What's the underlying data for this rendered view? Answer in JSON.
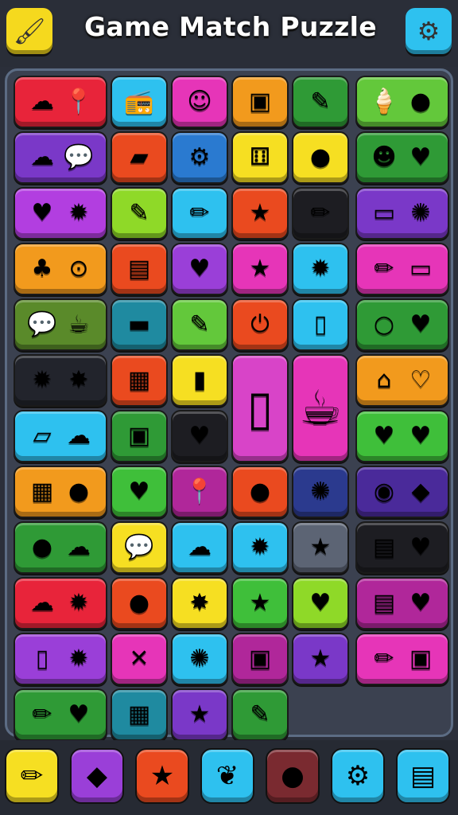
{
  "title": "Game Match Puzzle",
  "header": {
    "left_button": {
      "icon": "brush-icon",
      "glyph": "🖌",
      "color": "#f5d91e"
    },
    "right_button": {
      "icon": "gear-icon",
      "glyph": "⚙",
      "color": "#2ec1ef"
    }
  },
  "tiles": [
    {
      "row": 0,
      "col": 0,
      "span": 2,
      "color": "#e8243a",
      "icons": [
        {
          "name": "cloud-icon",
          "glyph": "☁"
        },
        {
          "name": "map-pin-icon",
          "glyph": "📍"
        }
      ]
    },
    {
      "row": 0,
      "col": 2,
      "span": 1,
      "color": "#2ec1ef",
      "icons": [
        {
          "name": "radio-icon",
          "glyph": "📻"
        }
      ]
    },
    {
      "row": 0,
      "col": 3,
      "span": 1,
      "color": "#e635b8",
      "icons": [
        {
          "name": "smiley-icon",
          "glyph": "☺"
        }
      ]
    },
    {
      "row": 0,
      "col": 4,
      "span": 1,
      "color": "#f29a1d",
      "icons": [
        {
          "name": "device-icon",
          "glyph": "▣"
        }
      ]
    },
    {
      "row": 0,
      "col": 5,
      "span": 1,
      "color": "#2f9a36",
      "icons": [
        {
          "name": "eraser-icon",
          "glyph": "✎"
        }
      ]
    },
    {
      "row": 0,
      "col": 6,
      "span": 2,
      "color": "#63c83b",
      "icons": [
        {
          "name": "ice-cream-icon",
          "glyph": "🍦"
        },
        {
          "name": "ball-icon",
          "glyph": "●"
        }
      ]
    },
    {
      "row": 1,
      "col": 0,
      "span": 2,
      "color": "#7a38c8",
      "icons": [
        {
          "name": "cloud-icon",
          "glyph": "☁"
        },
        {
          "name": "speech-bubble-icon",
          "glyph": "💬"
        }
      ]
    },
    {
      "row": 1,
      "col": 2,
      "span": 1,
      "color": "#ea4a1f",
      "icons": [
        {
          "name": "eraser-icon",
          "glyph": "▰"
        }
      ]
    },
    {
      "row": 1,
      "col": 3,
      "span": 1,
      "color": "#2a7ad0",
      "icons": [
        {
          "name": "gear-icon",
          "glyph": "⚙"
        }
      ]
    },
    {
      "row": 1,
      "col": 4,
      "span": 1,
      "color": "#f6df22",
      "icons": [
        {
          "name": "dice-icon",
          "glyph": "⚅"
        }
      ]
    },
    {
      "row": 1,
      "col": 5,
      "span": 1,
      "color": "#f6df22",
      "icons": [
        {
          "name": "ball-icon",
          "glyph": "●"
        }
      ]
    },
    {
      "row": 1,
      "col": 6,
      "span": 2,
      "color": "#2f9a36",
      "icons": [
        {
          "name": "pumpkin-icon",
          "glyph": "☻"
        },
        {
          "name": "heart-icon",
          "glyph": "♥"
        }
      ]
    },
    {
      "row": 2,
      "col": 0,
      "span": 2,
      "color": "#b23ee0",
      "icons": [
        {
          "name": "heart-icon",
          "glyph": "♥"
        },
        {
          "name": "sun-icon",
          "glyph": "✹"
        }
      ]
    },
    {
      "row": 2,
      "col": 2,
      "span": 1,
      "color": "#8fd928",
      "icons": [
        {
          "name": "eraser-icon",
          "glyph": "✎"
        }
      ]
    },
    {
      "row": 2,
      "col": 3,
      "span": 1,
      "color": "#2ec1ef",
      "icons": [
        {
          "name": "pencil-icon",
          "glyph": "✏"
        }
      ]
    },
    {
      "row": 2,
      "col": 4,
      "span": 1,
      "color": "#ea4a1f",
      "icons": [
        {
          "name": "star-icon",
          "glyph": "★"
        }
      ]
    },
    {
      "row": 2,
      "col": 5,
      "span": 1,
      "color": "#1d1d22",
      "icons": [
        {
          "name": "pencil-icon",
          "glyph": "✏"
        }
      ]
    },
    {
      "row": 2,
      "col": 6,
      "span": 2,
      "color": "#7a38c8",
      "icons": [
        {
          "name": "card-icon",
          "glyph": "▭"
        },
        {
          "name": "cookie-icon",
          "glyph": "✺"
        }
      ]
    },
    {
      "row": 3,
      "col": 0,
      "span": 2,
      "color": "#f29a1d",
      "icons": [
        {
          "name": "tree-icon",
          "glyph": "♣"
        },
        {
          "name": "map-pin-icon",
          "glyph": "⊙"
        }
      ]
    },
    {
      "row": 3,
      "col": 2,
      "span": 1,
      "color": "#ea4a1f",
      "icons": [
        {
          "name": "document-icon",
          "glyph": "▤"
        }
      ]
    },
    {
      "row": 3,
      "col": 3,
      "span": 1,
      "color": "#9a3fd8",
      "icons": [
        {
          "name": "heart-icon",
          "glyph": "♥"
        }
      ]
    },
    {
      "row": 3,
      "col": 4,
      "span": 1,
      "color": "#e635b8",
      "icons": [
        {
          "name": "star-icon",
          "glyph": "★"
        }
      ]
    },
    {
      "row": 3,
      "col": 5,
      "span": 1,
      "color": "#2ec1ef",
      "icons": [
        {
          "name": "sun-icon",
          "glyph": "✹"
        }
      ]
    },
    {
      "row": 3,
      "col": 6,
      "span": 2,
      "color": "#e635b8",
      "icons": [
        {
          "name": "pencil-icon",
          "glyph": "✏"
        },
        {
          "name": "speech-bubble-icon",
          "glyph": "▭"
        }
      ]
    },
    {
      "row": 4,
      "col": 0,
      "span": 2,
      "color": "#5a8a2a",
      "icons": [
        {
          "name": "speech-bubble-icon",
          "glyph": "💬"
        },
        {
          "name": "cup-icon",
          "glyph": "☕"
        }
      ]
    },
    {
      "row": 4,
      "col": 2,
      "span": 1,
      "color": "#1f8aa0",
      "icons": [
        {
          "name": "briefcase-icon",
          "glyph": "▬"
        }
      ]
    },
    {
      "row": 4,
      "col": 3,
      "span": 1,
      "color": "#63c83b",
      "icons": [
        {
          "name": "carrot-icon",
          "glyph": "✎"
        }
      ]
    },
    {
      "row": 4,
      "col": 4,
      "span": 1,
      "color": "#ea4a1f",
      "icons": [
        {
          "name": "power-icon",
          "glyph": "⏻"
        }
      ]
    },
    {
      "row": 4,
      "col": 5,
      "span": 1,
      "color": "#2ec1ef",
      "icons": [
        {
          "name": "phone-icon",
          "glyph": "▯"
        }
      ]
    },
    {
      "row": 4,
      "col": 6,
      "span": 2,
      "color": "#2f9a36",
      "icons": [
        {
          "name": "magnifier-icon",
          "glyph": "○"
        },
        {
          "name": "heart-icon",
          "glyph": "♥"
        }
      ]
    },
    {
      "row": 5,
      "col": 0,
      "span": 2,
      "color": "#22242c",
      "icons": [
        {
          "name": "sun-icon",
          "glyph": "✹"
        },
        {
          "name": "splat-icon",
          "glyph": "✸"
        }
      ]
    },
    {
      "row": 5,
      "col": 2,
      "span": 1,
      "color": "#ea4a1f",
      "icons": [
        {
          "name": "camera-icon",
          "glyph": "▦"
        }
      ]
    },
    {
      "row": 5,
      "col": 3,
      "span": 1,
      "color": "#f6df22",
      "icons": [
        {
          "name": "battery-icon",
          "glyph": "▮"
        }
      ]
    },
    {
      "row": 5,
      "col": 6,
      "span": 2,
      "color": "#f29a1d",
      "icons": [
        {
          "name": "house-icon",
          "glyph": "⌂"
        },
        {
          "name": "heart-icon",
          "glyph": "♡"
        }
      ]
    },
    {
      "row": 6,
      "col": 0,
      "span": 2,
      "color": "#2ec1ef",
      "icons": [
        {
          "name": "bandage-icon",
          "glyph": "▱"
        },
        {
          "name": "cloud-icon",
          "glyph": "☁"
        }
      ]
    },
    {
      "row": 6,
      "col": 2,
      "span": 1,
      "color": "#2f9a36",
      "icons": [
        {
          "name": "game-console-icon",
          "glyph": "▣"
        }
      ]
    },
    {
      "row": 6,
      "col": 3,
      "span": 1,
      "color": "#1d1d22",
      "icons": [
        {
          "name": "heart-icon",
          "glyph": "♥"
        }
      ]
    },
    {
      "row": 6,
      "col": 6,
      "span": 2,
      "color": "#3fbf3a",
      "icons": [
        {
          "name": "heart-icon",
          "glyph": "♥"
        },
        {
          "name": "heart-icon",
          "glyph": "♥"
        }
      ]
    },
    {
      "row": 7,
      "col": 0,
      "span": 2,
      "color": "#f29a1d",
      "icons": [
        {
          "name": "map-icon",
          "glyph": "▦"
        },
        {
          "name": "ball-icon",
          "glyph": "●"
        }
      ]
    },
    {
      "row": 7,
      "col": 2,
      "span": 1,
      "color": "#3fbf3a",
      "icons": [
        {
          "name": "heart-icon",
          "glyph": "♥"
        }
      ]
    },
    {
      "row": 7,
      "col": 3,
      "span": 1,
      "color": "#b0279a",
      "icons": [
        {
          "name": "map-pin-icon",
          "glyph": "📍"
        }
      ]
    },
    {
      "row": 7,
      "col": 4,
      "span": 1,
      "color": "#ea4a1f",
      "icons": [
        {
          "name": "apple-icon",
          "glyph": "●"
        }
      ]
    },
    {
      "row": 7,
      "col": 5,
      "span": 1,
      "color": "#2b3a8e",
      "icons": [
        {
          "name": "gear-icon",
          "glyph": "✺"
        }
      ]
    },
    {
      "row": 7,
      "col": 6,
      "span": 2,
      "color": "#4a2a9a",
      "icons": [
        {
          "name": "ball-icon",
          "glyph": "◉"
        },
        {
          "name": "origami-icon",
          "glyph": "◆"
        }
      ]
    },
    {
      "row": 8,
      "col": 0,
      "span": 2,
      "color": "#2f9a36",
      "icons": [
        {
          "name": "apple-icon",
          "glyph": "●"
        },
        {
          "name": "cloud-icon",
          "glyph": "☁"
        }
      ]
    },
    {
      "row": 8,
      "col": 2,
      "span": 1,
      "color": "#f6df22",
      "icons": [
        {
          "name": "speech-bubble-icon",
          "glyph": "💬"
        }
      ]
    },
    {
      "row": 8,
      "col": 3,
      "span": 1,
      "color": "#2ec1ef",
      "icons": [
        {
          "name": "cloud-icon",
          "glyph": "☁"
        }
      ]
    },
    {
      "row": 8,
      "col": 4,
      "span": 1,
      "color": "#2ec1ef",
      "icons": [
        {
          "name": "sun-icon",
          "glyph": "✹"
        }
      ]
    },
    {
      "row": 8,
      "col": 5,
      "span": 1,
      "color": "#5c6474",
      "icons": [
        {
          "name": "star-icon",
          "glyph": "★"
        }
      ]
    },
    {
      "row": 8,
      "col": 6,
      "span": 2,
      "color": "#1d1d22",
      "icons": [
        {
          "name": "document-icon",
          "glyph": "▤"
        },
        {
          "name": "heart-icon",
          "glyph": "♥"
        }
      ]
    },
    {
      "row": 9,
      "col": 0,
      "span": 2,
      "color": "#e8243a",
      "icons": [
        {
          "name": "cloud-icon",
          "glyph": "☁"
        },
        {
          "name": "monster-icon",
          "glyph": "✹"
        }
      ]
    },
    {
      "row": 9,
      "col": 2,
      "span": 1,
      "color": "#ea4a1f",
      "icons": [
        {
          "name": "balloon-icon",
          "glyph": "●"
        }
      ]
    },
    {
      "row": 9,
      "col": 3,
      "span": 1,
      "color": "#f6df22",
      "icons": [
        {
          "name": "star-icon",
          "glyph": "✸"
        }
      ]
    },
    {
      "row": 9,
      "col": 4,
      "span": 1,
      "color": "#3fbf3a",
      "icons": [
        {
          "name": "star-icon",
          "glyph": "★"
        }
      ]
    },
    {
      "row": 9,
      "col": 5,
      "span": 1,
      "color": "#8fd928",
      "icons": [
        {
          "name": "heart-icon",
          "glyph": "♥"
        }
      ]
    },
    {
      "row": 9,
      "col": 6,
      "span": 2,
      "color": "#b0279a",
      "icons": [
        {
          "name": "calendar-icon",
          "glyph": "▤"
        },
        {
          "name": "heart-icon",
          "glyph": "♥"
        }
      ]
    },
    {
      "row": 10,
      "col": 0,
      "span": 2,
      "color": "#9a3fd8",
      "icons": [
        {
          "name": "phone-icon",
          "glyph": "▯"
        },
        {
          "name": "sun-icon",
          "glyph": "✹"
        }
      ]
    },
    {
      "row": 10,
      "col": 2,
      "span": 1,
      "color": "#e635b8",
      "icons": [
        {
          "name": "scissors-icon",
          "glyph": "✕"
        }
      ]
    },
    {
      "row": 10,
      "col": 3,
      "span": 1,
      "color": "#2ec1ef",
      "icons": [
        {
          "name": "cookie-icon",
          "glyph": "✺"
        }
      ]
    },
    {
      "row": 10,
      "col": 4,
      "span": 1,
      "color": "#b0279a",
      "icons": [
        {
          "name": "box-icon",
          "glyph": "▣"
        }
      ]
    },
    {
      "row": 10,
      "col": 5,
      "span": 1,
      "color": "#7a38c8",
      "icons": [
        {
          "name": "star-icon",
          "glyph": "★"
        }
      ]
    },
    {
      "row": 10,
      "col": 6,
      "span": 2,
      "color": "#e635b8",
      "icons": [
        {
          "name": "pencil-icon",
          "glyph": "✏"
        },
        {
          "name": "camera-icon",
          "glyph": "▣"
        }
      ]
    },
    {
      "row": 11,
      "col": 0,
      "span": 2,
      "color": "#2f9a36",
      "icons": [
        {
          "name": "pencil-icon",
          "glyph": "✏"
        },
        {
          "name": "heart-icon",
          "glyph": "♥"
        }
      ]
    },
    {
      "row": 11,
      "col": 2,
      "span": 1,
      "color": "#1f8aa0",
      "icons": [
        {
          "name": "camera-icon",
          "glyph": "▦"
        }
      ]
    },
    {
      "row": 11,
      "col": 3,
      "span": 1,
      "color": "#7a38c8",
      "icons": [
        {
          "name": "star-icon",
          "glyph": "★"
        }
      ]
    },
    {
      "row": 11,
      "col": 4,
      "span": 1,
      "color": "#2f9a36",
      "icons": [
        {
          "name": "marker-icon",
          "glyph": "✎"
        }
      ]
    }
  ],
  "tall_tiles": [
    {
      "row": 5,
      "col": 4,
      "rows": 2,
      "color": "#d844c8",
      "icon": {
        "name": "tablet-icon",
        "glyph": "▯"
      }
    },
    {
      "row": 5,
      "col": 5,
      "rows": 2,
      "color": "#e635b8",
      "icon": {
        "name": "mug-icon",
        "glyph": "☕"
      }
    }
  ],
  "bottom_buttons": [
    {
      "name": "pencil-button",
      "icon": "pencil-icon",
      "glyph": "✏",
      "color": "#f6df22"
    },
    {
      "name": "gem-button",
      "icon": "gem-icon",
      "glyph": "◆",
      "color": "#9a3fd8"
    },
    {
      "name": "star-button",
      "icon": "star-icon",
      "glyph": "★",
      "color": "#ea4a1f"
    },
    {
      "name": "leaf-button",
      "icon": "leaf-icon",
      "glyph": "❦",
      "color": "#2ec1ef"
    },
    {
      "name": "cookie-button",
      "icon": "cookie-icon",
      "glyph": "●",
      "color": "#7a2a30"
    },
    {
      "name": "settings-button",
      "icon": "gear-icon",
      "glyph": "⚙",
      "color": "#2ec1ef"
    },
    {
      "name": "document-button",
      "icon": "document-icon",
      "glyph": "▤",
      "color": "#2ec1ef"
    }
  ]
}
